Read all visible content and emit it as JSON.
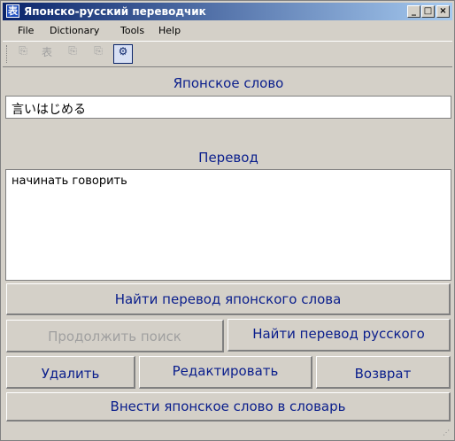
{
  "window": {
    "title": "Японско-русский переводчик",
    "icon": "app-icon"
  },
  "menu": [
    "File",
    "Dictionary",
    "Tools",
    "Help"
  ],
  "toolbar": {
    "buttons": [
      {
        "name": "toolbar-copy-icon",
        "icon": "⎘",
        "enabled": false
      },
      {
        "name": "toolbar-kanji-icon",
        "icon": "表",
        "enabled": false
      },
      {
        "name": "toolbar-paste-icon",
        "icon": "⎘",
        "enabled": false
      },
      {
        "name": "toolbar-clip-icon",
        "icon": "⎘",
        "enabled": false
      },
      {
        "name": "toolbar-settings-icon",
        "icon": "⚙",
        "enabled": true
      }
    ]
  },
  "japanese_word": {
    "label": "Японское слово",
    "value": "言いはじめる"
  },
  "translation": {
    "label": "Перевод",
    "value": "начинать говорить"
  },
  "buttons": {
    "find_japanese": "Найти перевод японского слова",
    "continue_search": "Продолжить поиск",
    "find_russian": "Найти перевод русского",
    "delete": "Удалить",
    "edit": "Редактировать",
    "back": "Возврат",
    "add_to_dictionary": "Внести японское слово в словарь"
  }
}
